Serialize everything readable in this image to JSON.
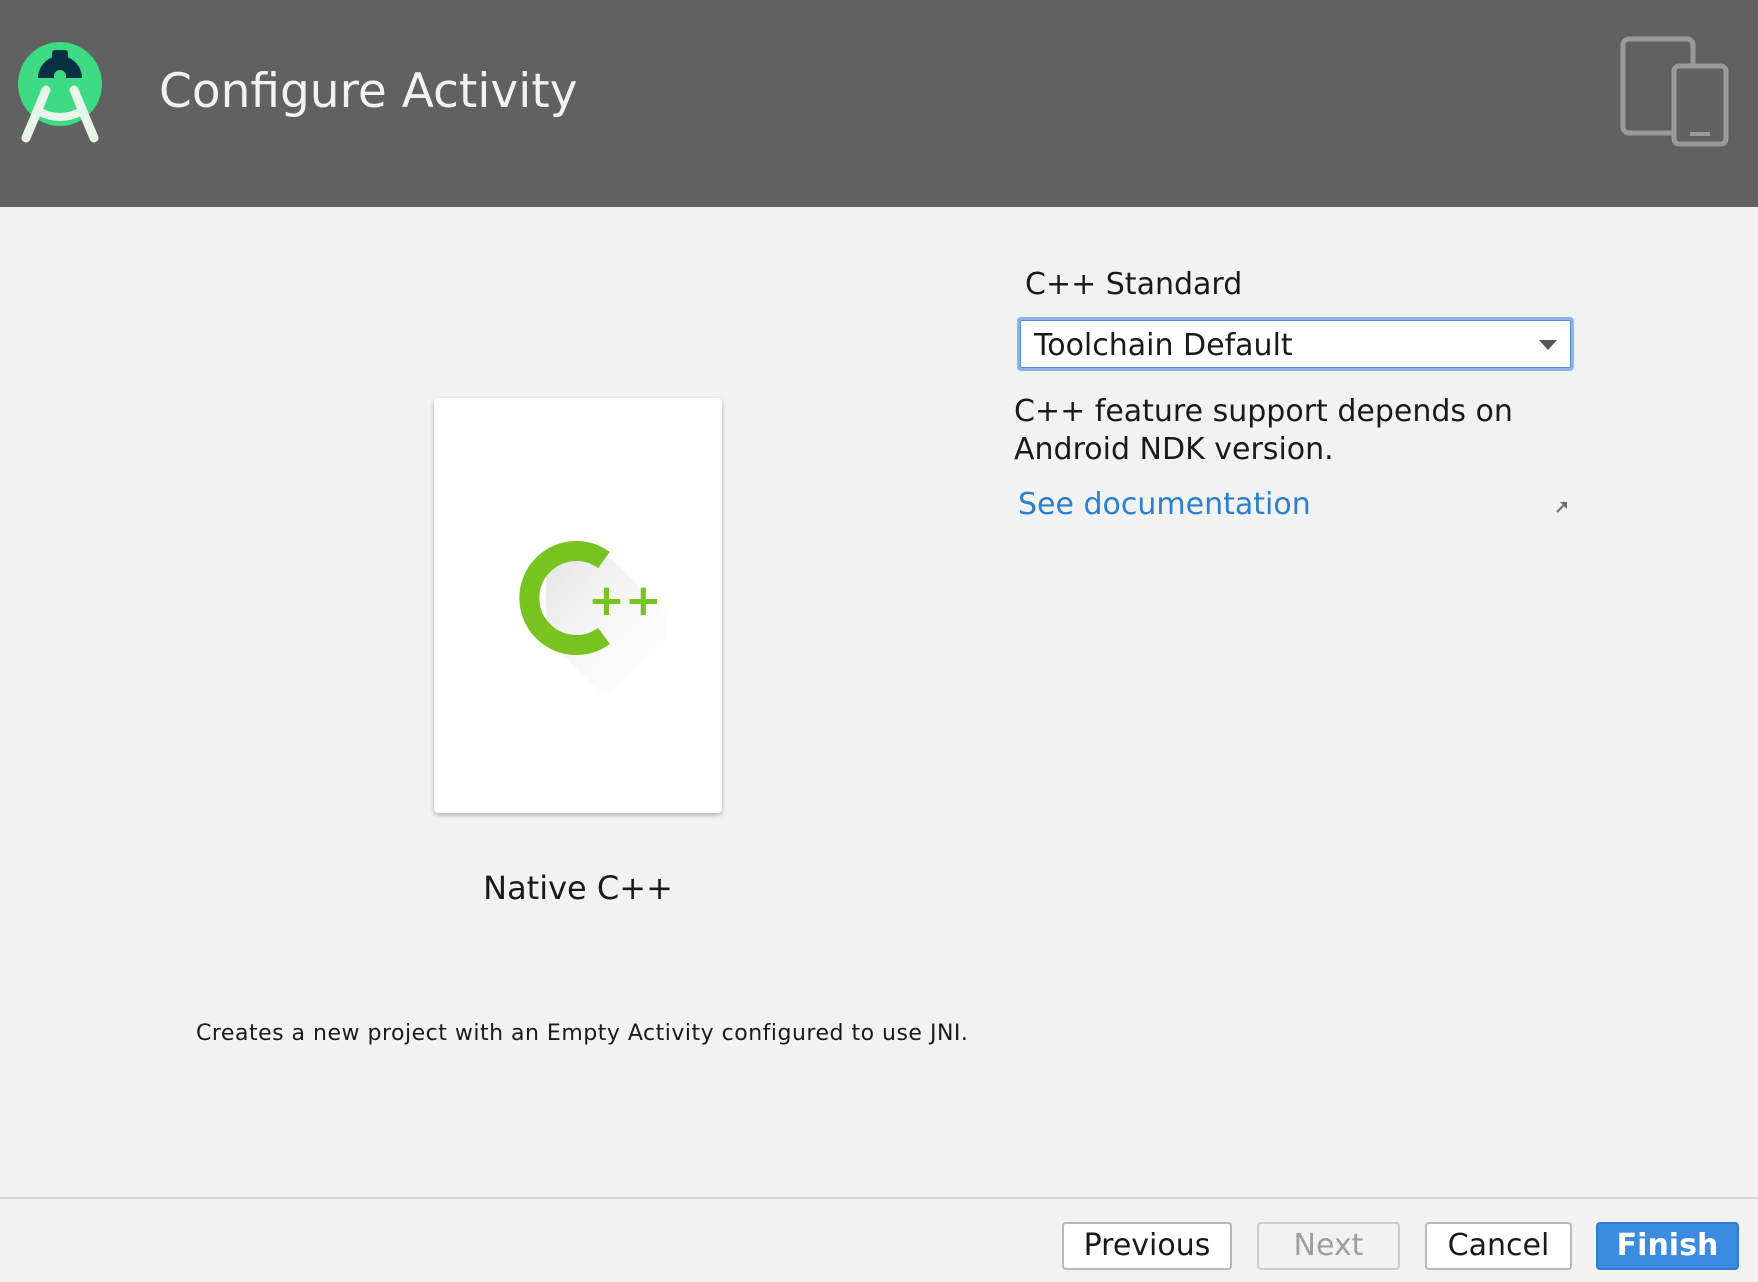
{
  "header": {
    "title": "Configure Activity",
    "logo_icon": "android-studio-icon",
    "device_icon": "tablet-phone-icon"
  },
  "template": {
    "name": "Native C++",
    "icon": "cpp-icon",
    "description": "Creates a new project with an Empty Activity configured to use JNI."
  },
  "options": {
    "cpp_standard_label": "C++ Standard",
    "cpp_standard_value": "Toolchain Default",
    "support_text": "C++ feature support depends on Android NDK version.",
    "doc_link": "See documentation"
  },
  "footer": {
    "previous": "Previous",
    "next": "Next",
    "cancel": "Cancel",
    "finish": "Finish"
  },
  "colors": {
    "header_bg": "#616161",
    "accent": "#3b8be0",
    "cpp_green": "#78c31f",
    "link": "#2a7fd0"
  }
}
